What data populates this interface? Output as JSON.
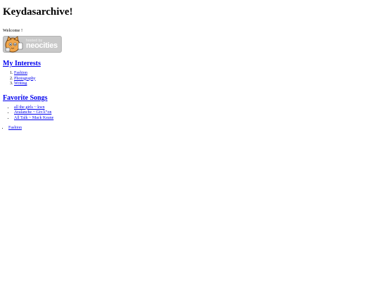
{
  "header": {
    "title": "Keydasarchive!"
  },
  "welcome_text": "Welcome !",
  "badge": {
    "hosted_label": "hosted by",
    "brand": "neocities",
    "icon": "neocities-cat-logo"
  },
  "interests": {
    "heading": "My Interests",
    "items": [
      "Fashion",
      "Photography",
      "Writing"
    ]
  },
  "songs": {
    "heading": "Favorite Songs",
    "items": [
      "all the girls ~ kwn",
      "Avalanche ~ GivÃ“on",
      "All Talk ~ Mack Keane"
    ]
  },
  "extra_links": [
    "Fashion"
  ],
  "colors": {
    "link": "#0000ee",
    "text": "#000000",
    "badge_bg": "#c9c9c9"
  }
}
